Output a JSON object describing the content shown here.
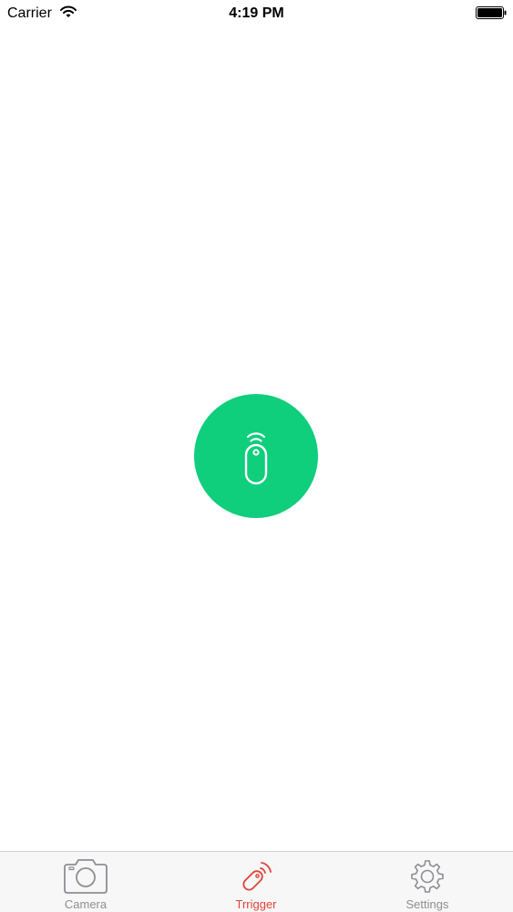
{
  "status_bar": {
    "carrier": "Carrier",
    "time": "4:19 PM",
    "wifi_icon": "wifi-icon",
    "battery_icon": "battery-full-icon"
  },
  "main": {
    "trigger_button": {
      "icon": "remote-shutter-icon",
      "color": "#0fce7c"
    }
  },
  "tab_bar": {
    "active_color": "#e0433a",
    "inactive_color": "#8e8e93",
    "tabs": [
      {
        "label": "Camera",
        "icon": "camera-icon",
        "active": false
      },
      {
        "label": "Trrigger",
        "icon": "remote-shutter-icon",
        "active": true
      },
      {
        "label": "Settings",
        "icon": "gear-icon",
        "active": false
      }
    ]
  }
}
